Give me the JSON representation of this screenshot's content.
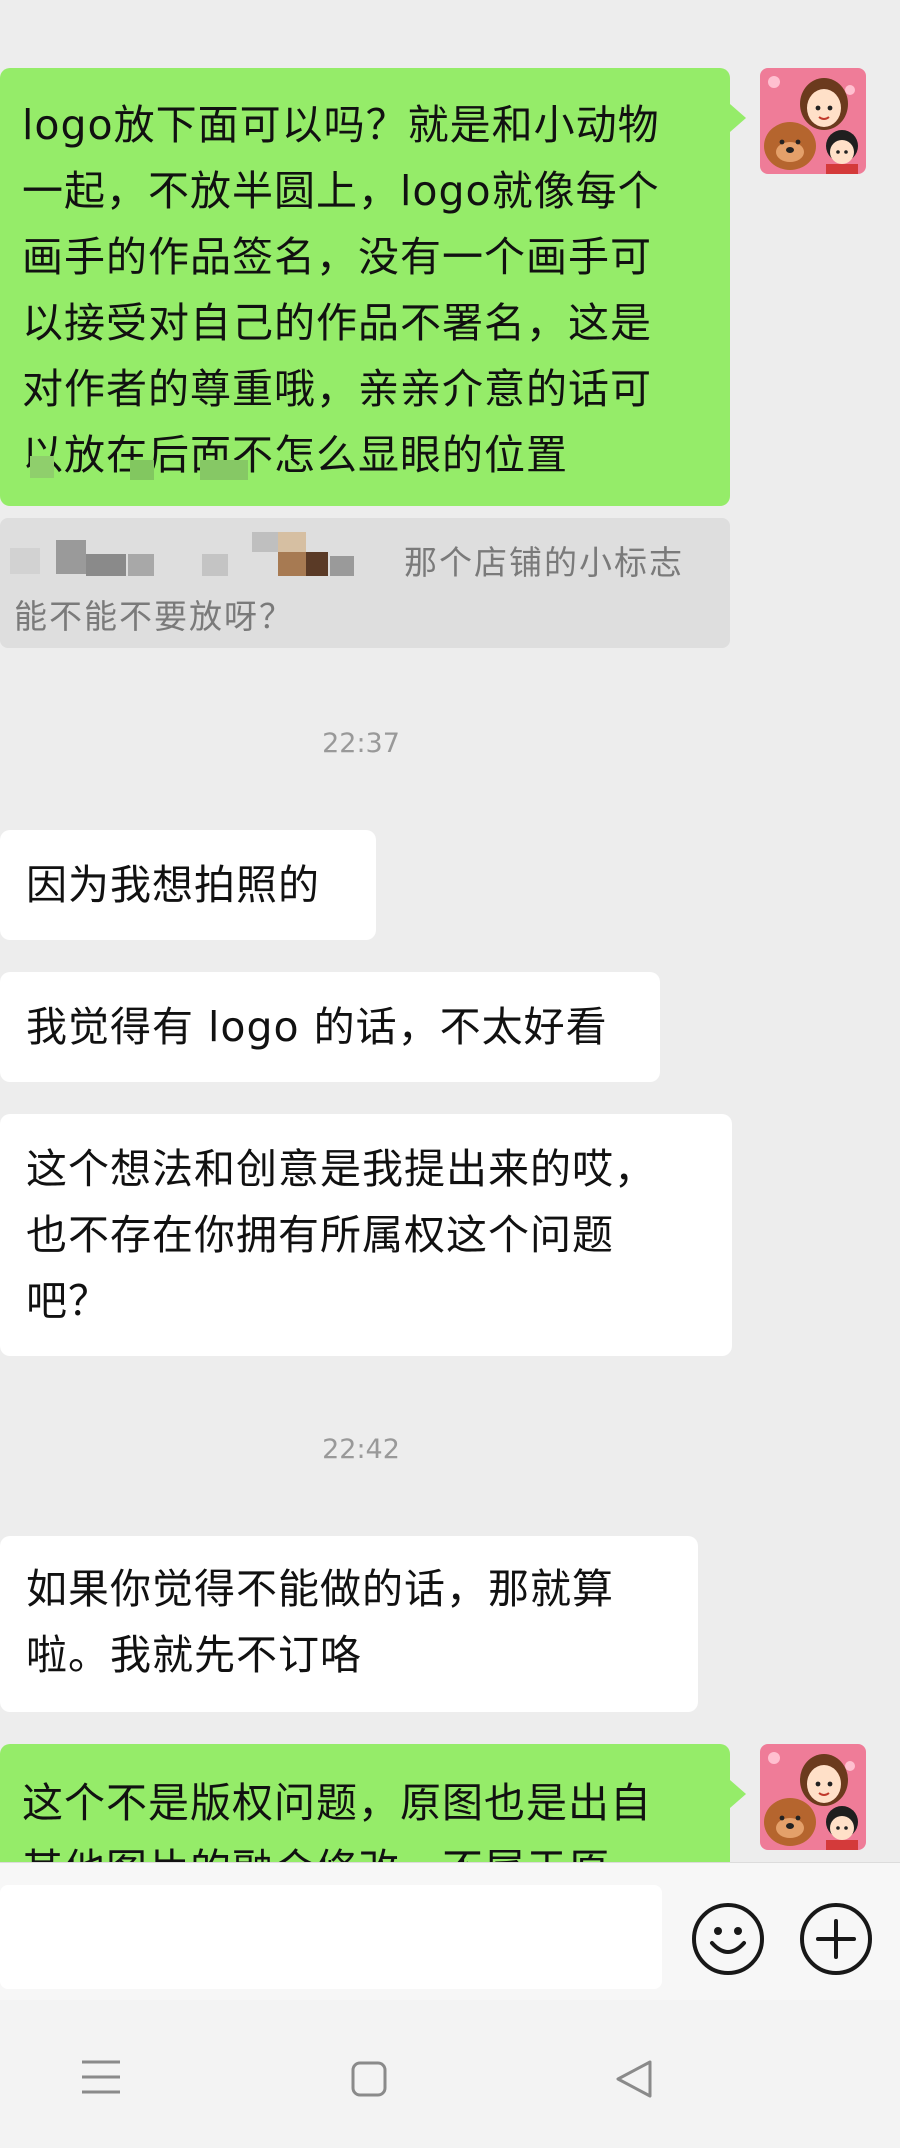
{
  "messages": {
    "m1": {
      "lines": [
        "logo放下面可以吗？就是和小动物",
        "一起，不放半圆上，logo就像每个",
        "画手的作品签名，没有一个画手可",
        "以接受对自己的作品不署名，这是",
        "对作者的尊重哦，亲亲介意的话可",
        "以放在后面不怎么显眼的位置"
      ]
    },
    "quote": {
      "line1": "那个店铺的小标志",
      "line2": "能不能不要放呀？"
    },
    "time1": "22:37",
    "m2": "因为我想拍照的",
    "m3": "我觉得有 logo 的话，不太好看",
    "m4": {
      "lines": [
        "这个想法和创意是我提出来的哎，",
        "也不存在你拥有所属权这个问题",
        "吧？"
      ]
    },
    "time2": "22:42",
    "m5": {
      "lines": [
        "如果你觉得不能做的话，那就算",
        "啦。我就先不订咯"
      ]
    },
    "m6": {
      "lines": [
        "这个不是版权问题，原图也是出自",
        "其他图片的融合修改，不属于原"
      ]
    }
  },
  "icons": {
    "avatar": "avatar-cartoon-couple-with-dog",
    "emoji": "smiley-icon",
    "plus": "plus-circle-icon",
    "nav_menu": "menu-icon",
    "nav_home": "home-square-icon",
    "nav_back": "back-triangle-icon"
  },
  "colors": {
    "outgoing_bubble": "#95ec69",
    "incoming_bubble": "#ffffff",
    "background": "#ededed"
  }
}
